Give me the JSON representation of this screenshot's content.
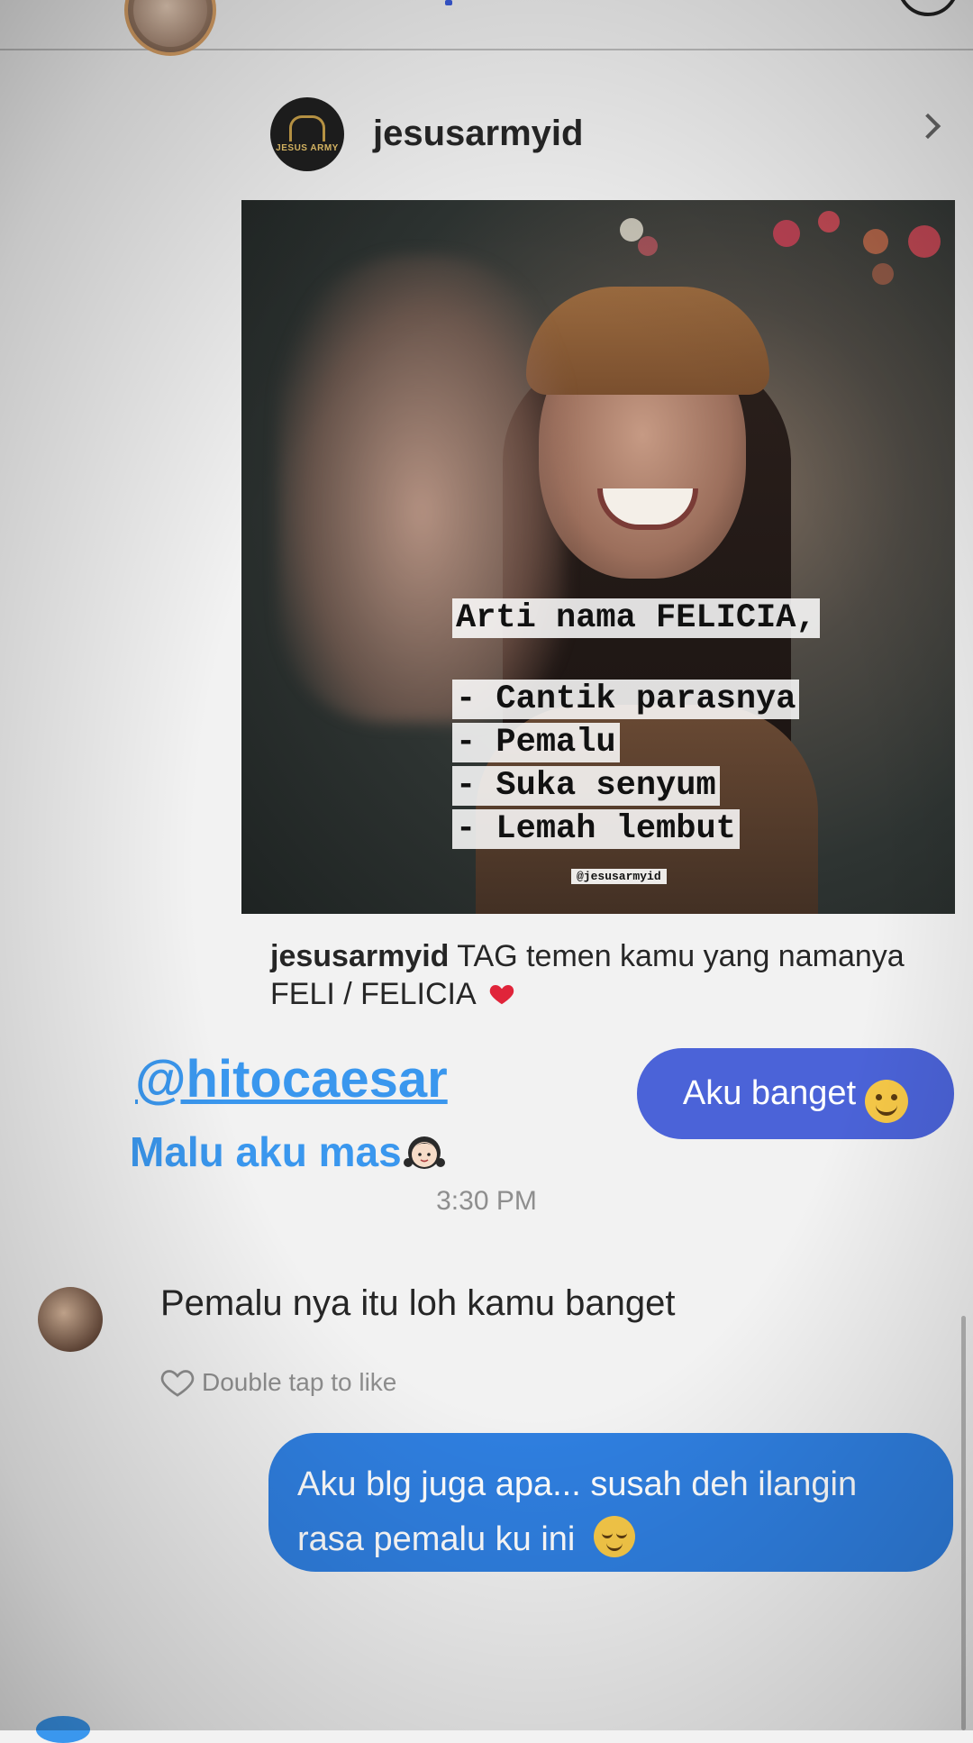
{
  "post": {
    "username": "jesusarmyid",
    "avatar_logo_text": "JESUS ARMY",
    "image_text": {
      "title": "Arti nama FELICIA,",
      "lines": [
        "- Cantik parasnya",
        "- Pemalu",
        "- Suka senyum",
        "- Lemah lembut"
      ],
      "credit": "@jesusarmyid"
    },
    "caption_user": "jesusarmyid",
    "caption_text": " TAG temen kamu yang namanya FELI / FELICIA"
  },
  "story_mention": {
    "handle": "@hitocaesar",
    "text": "Malu aku mas"
  },
  "messages": {
    "sent_1": "Aku banget",
    "timestamp": "3:30 PM",
    "received_1": "Pemalu nya itu loh kamu banget",
    "like_hint": "Double tap to like",
    "sent_2": "Aku blg juga apa... susah deh ilangin rasa pemalu ku ini"
  },
  "icons": {
    "chevron": "chevron-right-icon",
    "heart": "heart-outline-icon",
    "emoji_1": "smiling-face-icon",
    "emoji_2": "relieved-face-icon",
    "emoji_3": "girl-emoji-icon",
    "emoji_4": "red-heart-icon"
  },
  "colors": {
    "sent_bubble_1": "#4b63d8",
    "sent_bubble_2": "#2f7fe0",
    "mention_blue": "#3a97ee",
    "secondary_text": "#8e8e8e"
  }
}
